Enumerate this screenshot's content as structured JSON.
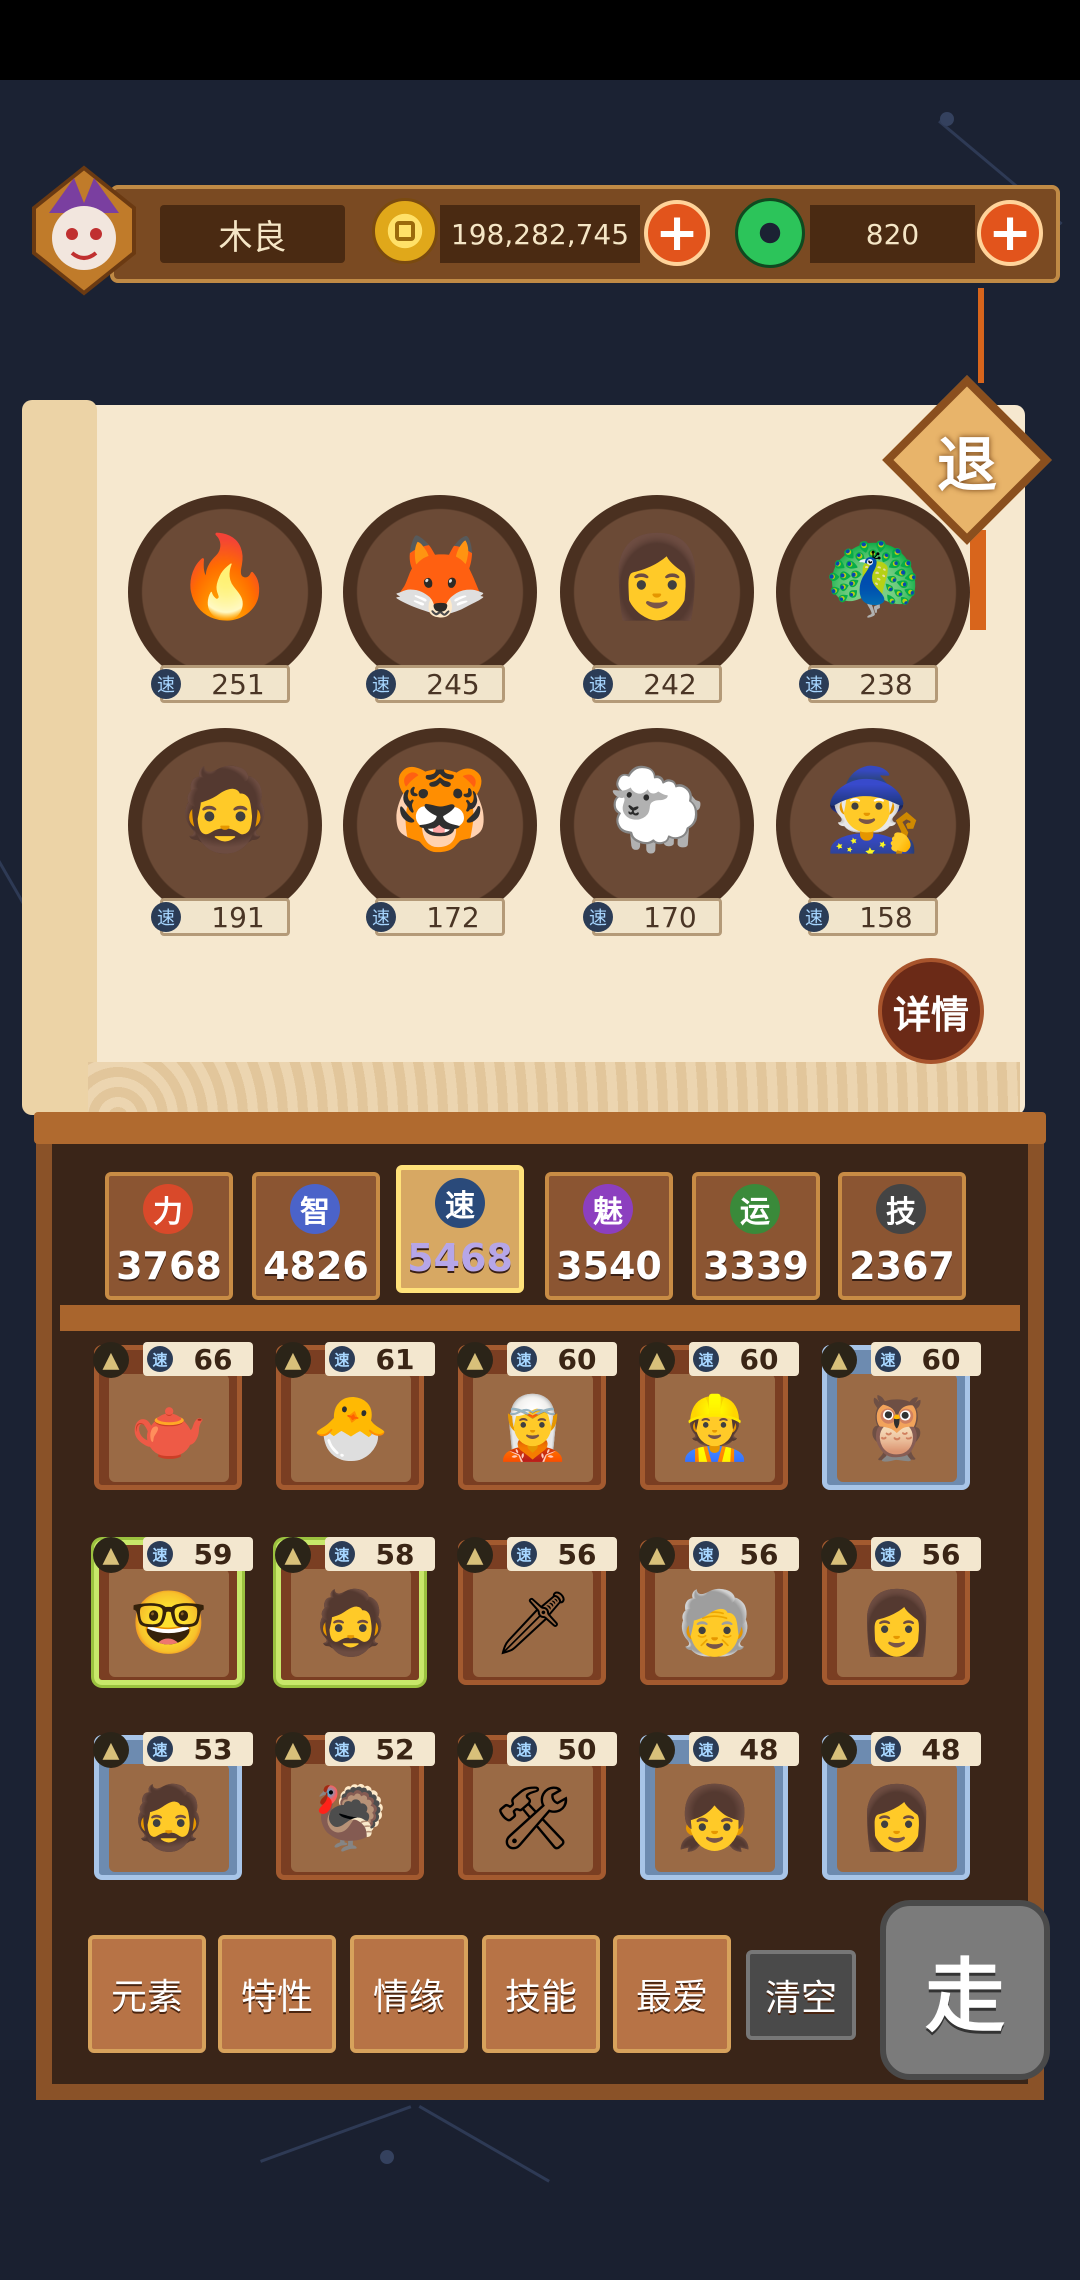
{
  "player": {
    "name": "木良"
  },
  "currency": {
    "gold": "198,282,745",
    "jade": "820",
    "plus": "+"
  },
  "exit_label": "退",
  "detail_label": "详情",
  "speed_icon": "速",
  "top_heroes": [
    {
      "speed": "251",
      "icon": "🔥"
    },
    {
      "speed": "245",
      "icon": "🦊"
    },
    {
      "speed": "242",
      "icon": "👩"
    },
    {
      "speed": "238",
      "icon": "🦚"
    },
    {
      "speed": "191",
      "icon": "🧔"
    },
    {
      "speed": "172",
      "icon": "🐯"
    },
    {
      "speed": "170",
      "icon": "🐑"
    },
    {
      "speed": "158",
      "icon": "🧙"
    }
  ],
  "stats": [
    {
      "icon": "力",
      "value": "3768",
      "color": "#d9492a",
      "active": false
    },
    {
      "icon": "智",
      "value": "4826",
      "color": "#4b63c9",
      "active": false
    },
    {
      "icon": "速",
      "value": "5468",
      "color": "#2a4a7a",
      "active": true
    },
    {
      "icon": "魅",
      "value": "3540",
      "color": "#8c3fbf",
      "active": false
    },
    {
      "icon": "运",
      "value": "3339",
      "color": "#3a8a3a",
      "active": false
    },
    {
      "icon": "技",
      "value": "2367",
      "color": "#444444",
      "active": false
    }
  ],
  "cards": [
    {
      "speed": "66",
      "style": "normal",
      "icon": "🫖"
    },
    {
      "speed": "61",
      "style": "normal",
      "icon": "🐣"
    },
    {
      "speed": "60",
      "style": "normal",
      "icon": "🧝"
    },
    {
      "speed": "60",
      "style": "normal",
      "icon": "👷"
    },
    {
      "speed": "60",
      "style": "silver",
      "icon": "🦉"
    },
    {
      "speed": "59",
      "style": "selected",
      "icon": "🤓"
    },
    {
      "speed": "58",
      "style": "selected",
      "icon": "🧔"
    },
    {
      "speed": "56",
      "style": "normal",
      "icon": "🗡"
    },
    {
      "speed": "56",
      "style": "normal",
      "icon": "🧓"
    },
    {
      "speed": "56",
      "style": "normal",
      "icon": "👩"
    },
    {
      "speed": "53",
      "style": "silver",
      "icon": "🧔"
    },
    {
      "speed": "52",
      "style": "normal",
      "icon": "🦃"
    },
    {
      "speed": "50",
      "style": "normal",
      "icon": "🛠"
    },
    {
      "speed": "48",
      "style": "silver",
      "icon": "👧"
    },
    {
      "speed": "48",
      "style": "silver",
      "icon": "👩"
    }
  ],
  "filters": [
    "元素",
    "特性",
    "情缘",
    "技能",
    "最爱"
  ],
  "clear_label": "清空",
  "go_label": "走"
}
